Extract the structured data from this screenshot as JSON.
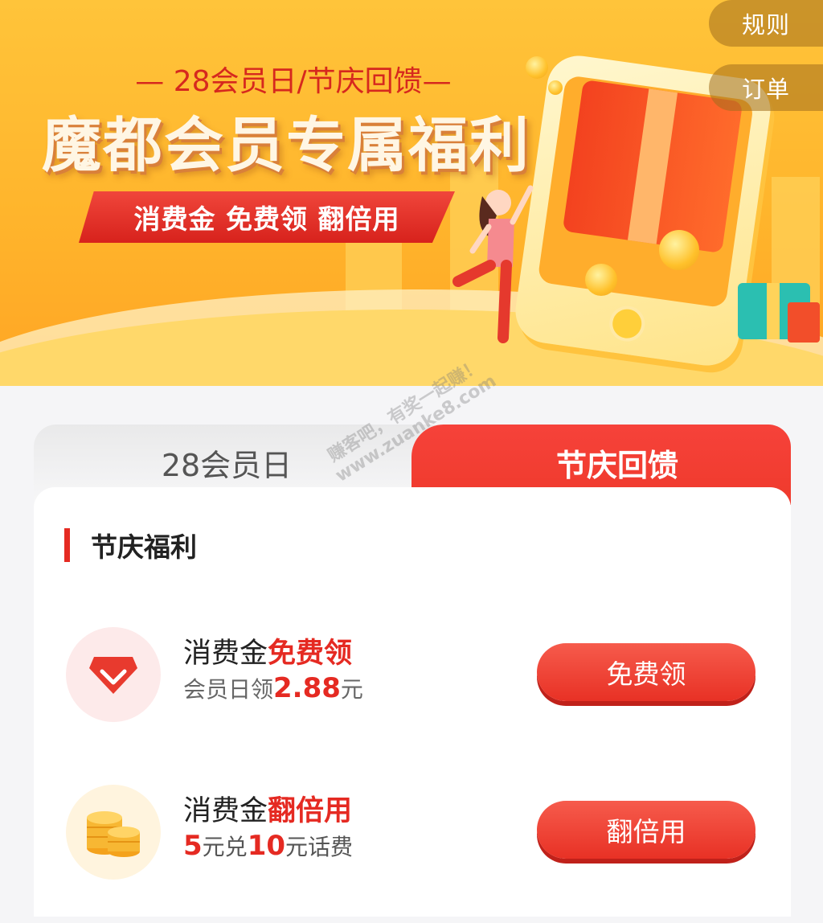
{
  "header": {
    "rules_label": "规则",
    "orders_label": "订单",
    "subtitle": "— 28会员日/节庆回馈—",
    "title": "魔都会员专属福利",
    "ribbon": "消费金 免费领 翻倍用"
  },
  "tabs": [
    {
      "label": "28会员日",
      "active": false
    },
    {
      "label": "节庆回馈",
      "active": true
    }
  ],
  "section": {
    "title": "节庆福利"
  },
  "items": [
    {
      "title_prefix": "消费金",
      "title_highlight": "免费领",
      "sub_prefix": "会员日领",
      "sub_num": "2.88",
      "sub_suffix": "元",
      "button": "免费领",
      "icon": "diamond-icon"
    },
    {
      "title_prefix": "消费金",
      "title_highlight": "翻倍用",
      "sub_num1": "5",
      "sub_mid": "元兑",
      "sub_num2": "10",
      "sub_suffix": "元话费",
      "button": "翻倍用",
      "icon": "coins-icon"
    }
  ],
  "watermark": {
    "line1": "赚客吧，有奖一起赚！",
    "line2": "www.zuanke8.com"
  },
  "colors": {
    "accent": "#e52a22",
    "banner": "#ffb52c"
  }
}
